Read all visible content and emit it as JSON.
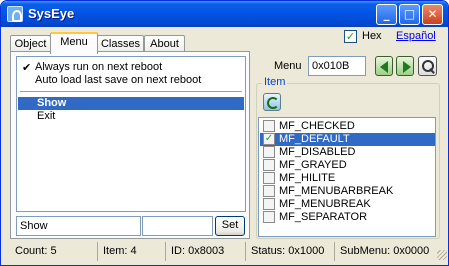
{
  "window": {
    "title": "SysEye",
    "controls": [
      "minimize-icon",
      "maximize-icon",
      "close-icon"
    ]
  },
  "tabs": [
    {
      "label": "Object",
      "active": false
    },
    {
      "label": "Menu",
      "active": true
    },
    {
      "label": "Classes",
      "active": false
    },
    {
      "label": "About",
      "active": false
    }
  ],
  "menu_list": {
    "options": [
      {
        "label": "Always run on next reboot",
        "checked": true
      },
      {
        "label": "Auto load last save on next reboot",
        "checked": false
      }
    ],
    "items": [
      {
        "label": "Show",
        "selected": true
      },
      {
        "label": "Exit",
        "selected": false
      }
    ]
  },
  "edit": {
    "value": "Show",
    "value2": "",
    "set_label": "Set"
  },
  "hex": {
    "label": "Hex",
    "checked": true
  },
  "language_link": "Español",
  "menu_field": {
    "label": "Menu",
    "value": "0x010B"
  },
  "item_group": {
    "title": "Item",
    "flags": [
      {
        "name": "MF_CHECKED",
        "checked": false,
        "selected": false
      },
      {
        "name": "MF_DEFAULT",
        "checked": true,
        "selected": true
      },
      {
        "name": "MF_DISABLED",
        "checked": false,
        "selected": false
      },
      {
        "name": "MF_GRAYED",
        "checked": false,
        "selected": false
      },
      {
        "name": "MF_HILITE",
        "checked": false,
        "selected": false
      },
      {
        "name": "MF_MENUBARBREAK",
        "checked": false,
        "selected": false
      },
      {
        "name": "MF_MENUBREAK",
        "checked": false,
        "selected": false
      },
      {
        "name": "MF_SEPARATOR",
        "checked": false,
        "selected": false
      }
    ]
  },
  "status": {
    "count": "Count: 5",
    "item": "Item: 4",
    "id": "ID: 0x8003",
    "status": "Status: 0x1000",
    "submenu": "SubMenu: 0x0000"
  },
  "colors": {
    "title_bar": "#0254e2",
    "selection": "#316ac5",
    "face": "#ece9d8",
    "active_tab": "#ffc73c"
  }
}
